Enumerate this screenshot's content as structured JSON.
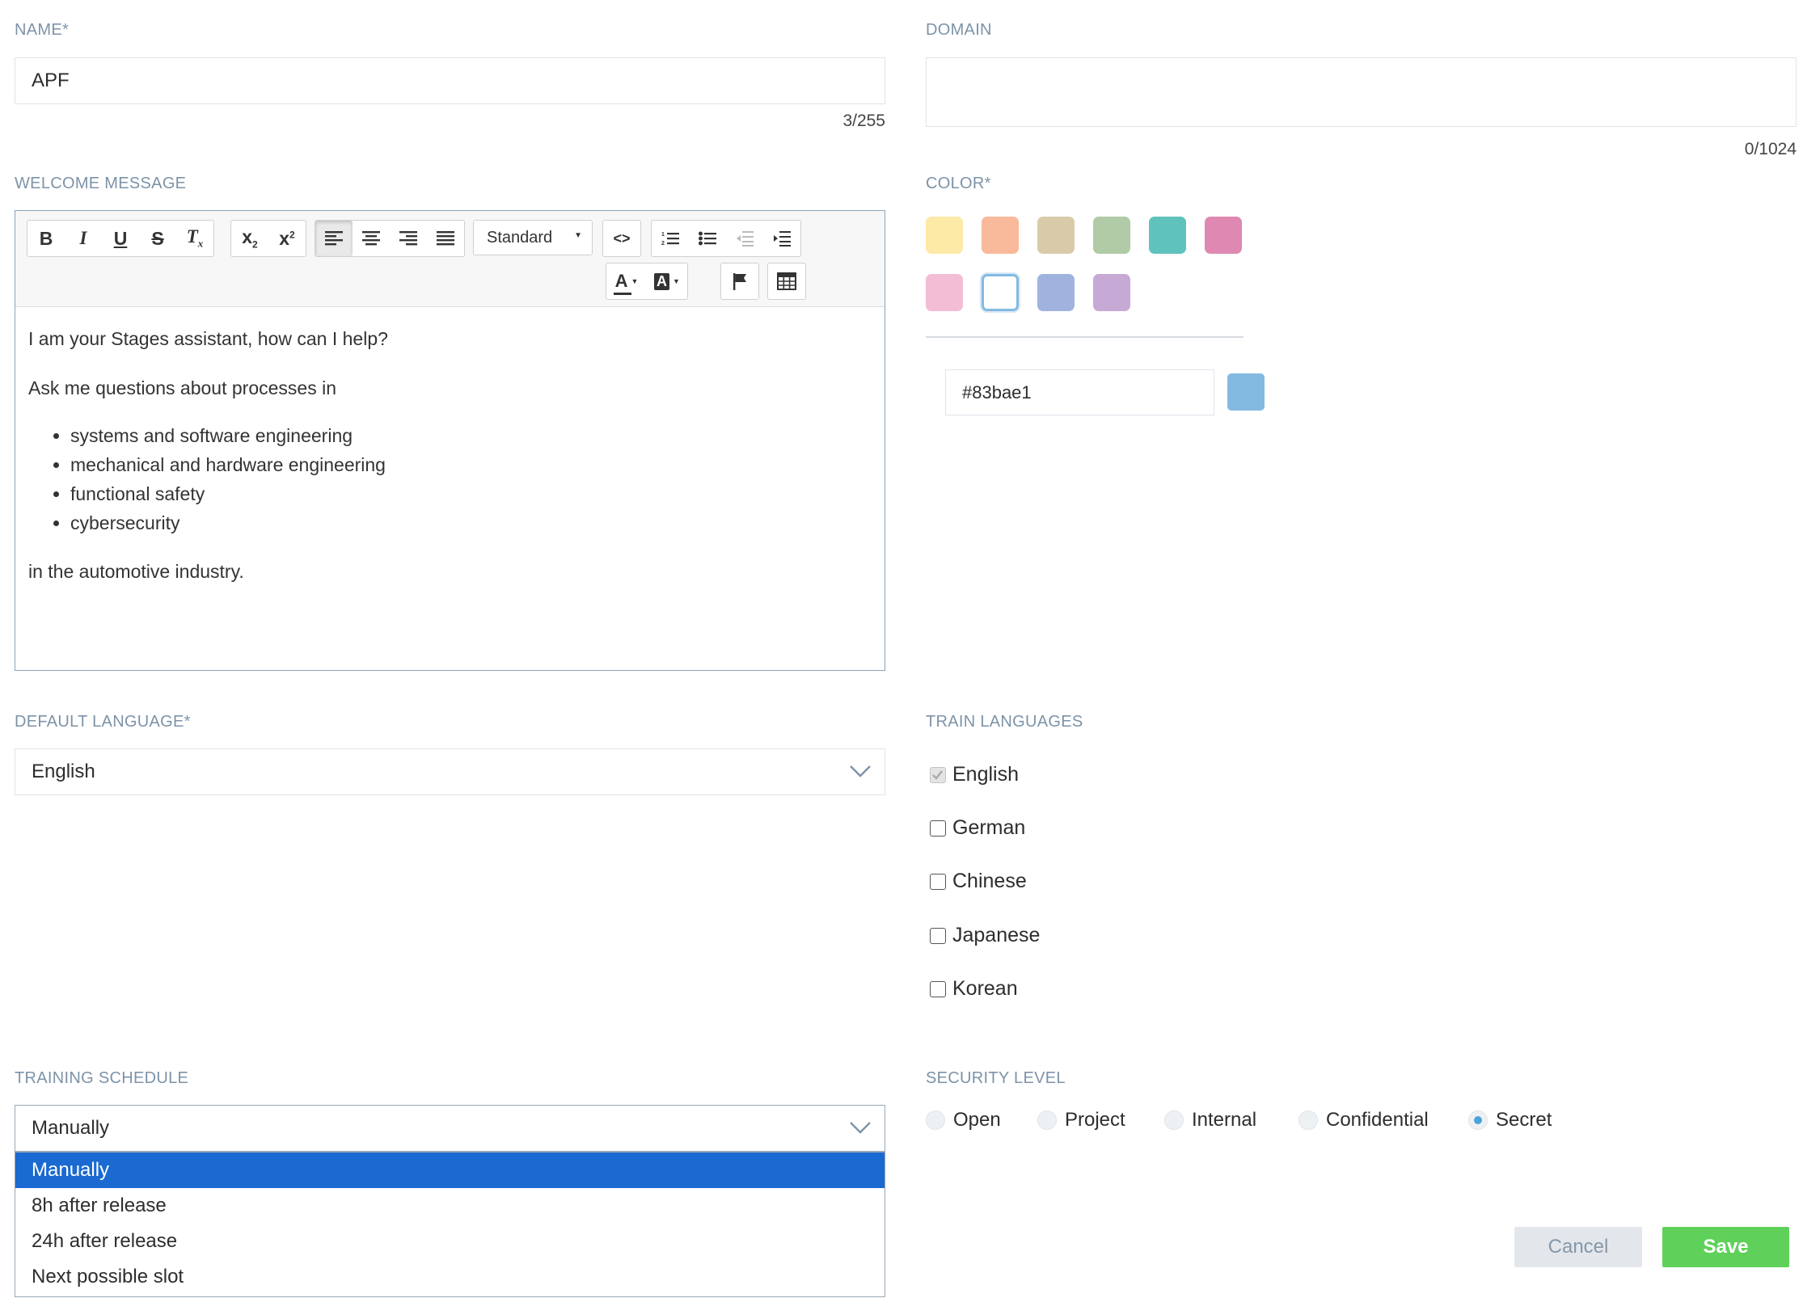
{
  "name": {
    "label": "NAME*",
    "value": "APF",
    "counter": "3/255"
  },
  "domain": {
    "label": "DOMAIN",
    "value": "",
    "counter": "0/1024"
  },
  "welcome": {
    "label": "WELCOME MESSAGE",
    "toolbar": {
      "format_select": "Standard"
    },
    "body": {
      "p1": "I am your Stages assistant, how can I help?",
      "p2": "Ask me questions about processes in",
      "items": [
        "systems and software engineering",
        "mechanical and hardware engineering",
        "functional safety",
        "cybersecurity"
      ],
      "p3": "in the automotive industry."
    }
  },
  "color": {
    "label": "COLOR*",
    "swatches": [
      "#fdeaa7",
      "#f9b99b",
      "#d9cbaa",
      "#b0cba6",
      "#5fc2bd",
      "#df89b2",
      "#f3bdd6",
      "#ffffff",
      "#a0b3de",
      "#c6a9d5"
    ],
    "selected_index": 7,
    "hex_value": "#83bae1",
    "preview": "#83bae1"
  },
  "default_language": {
    "label": "DEFAULT LANGUAGE*",
    "value": "English"
  },
  "train_languages": {
    "label": "TRAIN LANGUAGES",
    "options": [
      {
        "label": "English",
        "checked": true,
        "disabled": true
      },
      {
        "label": "German",
        "checked": false
      },
      {
        "label": "Chinese",
        "checked": false
      },
      {
        "label": "Japanese",
        "checked": false
      },
      {
        "label": "Korean",
        "checked": false
      }
    ]
  },
  "training_schedule": {
    "label": "TRAINING SCHEDULE",
    "value": "Manually",
    "options": [
      "Manually",
      "8h after release",
      "24h after release",
      "Next possible slot"
    ]
  },
  "security_level": {
    "label": "SECURITY LEVEL",
    "options": [
      "Open",
      "Project",
      "Internal",
      "Confidential",
      "Secret"
    ],
    "selected": "Secret"
  },
  "actions": {
    "cancel": "Cancel",
    "save": "Save"
  }
}
